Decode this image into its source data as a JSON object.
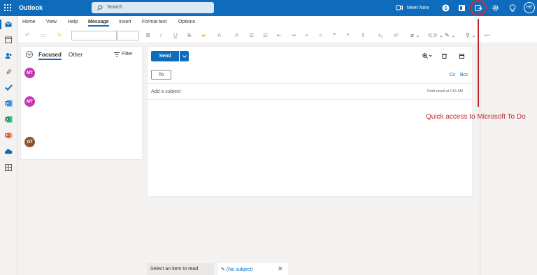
{
  "app": {
    "title": "Outlook"
  },
  "search": {
    "placeholder": "Search"
  },
  "topbar": {
    "meet_now": "Meet Now",
    "user_initials": "HE"
  },
  "ribbon": {
    "tabs": [
      "Home",
      "View",
      "Help",
      "Message",
      "Insert",
      "Format text",
      "Options"
    ],
    "active_tab": "Message"
  },
  "message_list": {
    "tabs": {
      "focused": "Focused",
      "other": "Other"
    },
    "filter": "Filter",
    "avatars": [
      {
        "initials": "MT",
        "color": "#c239b3"
      },
      {
        "initials": "MT",
        "color": "#c239b3"
      },
      {
        "initials": "OT",
        "color": "#8e562e"
      }
    ]
  },
  "compose": {
    "send": "Send",
    "to": "To",
    "cc": "Cc",
    "bcc": "Bcc",
    "subject_placeholder": "Add a subject",
    "draft_status": "Draft saved at 1:51 AM"
  },
  "bottom_tabs": {
    "reading": "Select an item to read",
    "draft": "(No subject)"
  },
  "annotation": {
    "text": "Quick access to Microsoft To Do"
  },
  "colors": {
    "brand": "#0f6cbd",
    "annotation": "#c4262e"
  }
}
